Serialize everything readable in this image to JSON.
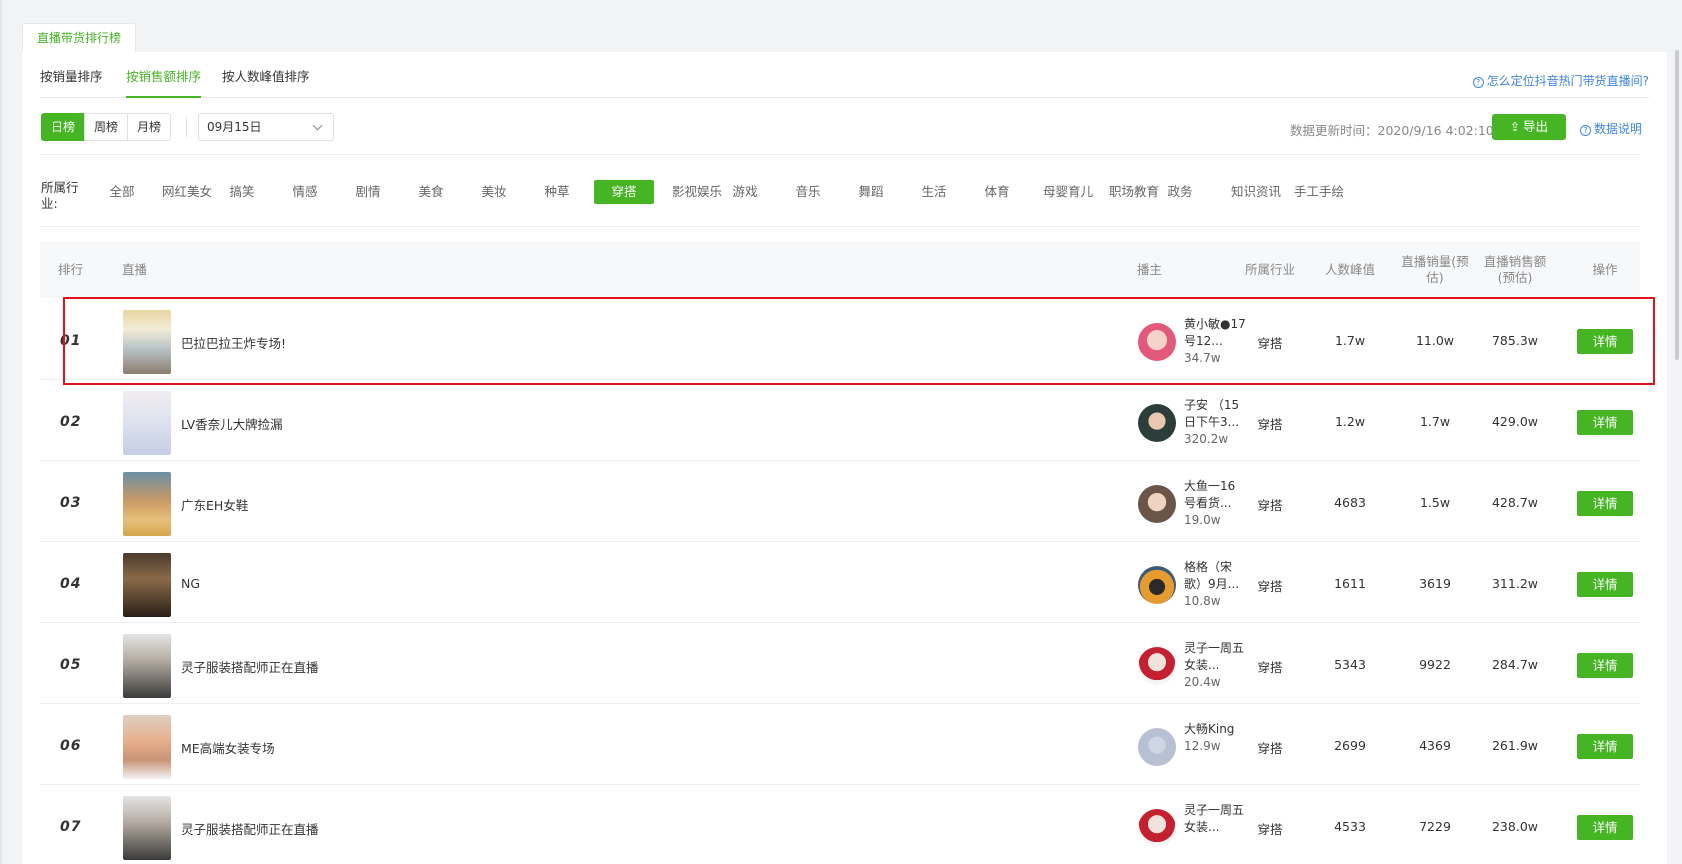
{
  "outer_tab": "直播带货排行榜",
  "sort_tabs": [
    "按销量排序",
    "按销售额排序",
    "按人数峰值排序"
  ],
  "active_sort_tab": 1,
  "help_link": "怎么定位抖音热门带货直播间?",
  "period_buttons": [
    "日榜",
    "周榜",
    "月榜"
  ],
  "active_period": 0,
  "date_value": "09月15日",
  "update_time": "数据更新时间：2020/9/16 4:02:10",
  "export_label": "导出",
  "data_explain": "数据说明",
  "industry_label": "所属行业:",
  "industries": [
    "全部",
    "网红美女",
    "搞笑",
    "情感",
    "剧情",
    "美食",
    "美妆",
    "种草",
    "穿搭",
    "影视娱乐",
    "游戏",
    "音乐",
    "舞蹈",
    "生活",
    "体育",
    "母婴育儿",
    "职场教育",
    "政务",
    "知识资讯",
    "手工手绘"
  ],
  "active_industry": "穿搭",
  "table_headers": {
    "rank": "排行",
    "live": "直播",
    "anchor": "播主",
    "industry": "所属行业",
    "peak": "人数峰值",
    "sales": "直播销量(预估)",
    "revenue": "直播销售额(预估)",
    "action": "操作"
  },
  "rows": [
    {
      "rank": "01",
      "title": "巴拉巴拉王炸专场!",
      "anchor": "黄小敏●17号12...",
      "fans": "34.7w",
      "industry": "穿搭",
      "peak": "1.7w",
      "sales": "11.0w",
      "revenue": "785.3w",
      "action": "详情"
    },
    {
      "rank": "02",
      "title": "LV香奈儿大牌捡漏",
      "anchor": "子安 （15日下午3...",
      "fans": "320.2w",
      "industry": "穿搭",
      "peak": "1.2w",
      "sales": "1.7w",
      "revenue": "429.0w",
      "action": "详情"
    },
    {
      "rank": "03",
      "title": "广东EH女鞋",
      "anchor": "大鱼一16号看货...",
      "fans": "19.0w",
      "industry": "穿搭",
      "peak": "4683",
      "sales": "1.5w",
      "revenue": "428.7w",
      "action": "详情"
    },
    {
      "rank": "04",
      "title": "NG",
      "anchor": "格格（宋歌）9月...",
      "fans": "10.8w",
      "industry": "穿搭",
      "peak": "1611",
      "sales": "3619",
      "revenue": "311.2w",
      "action": "详情"
    },
    {
      "rank": "05",
      "title": "灵子服装搭配师正在直播",
      "anchor": "灵子一周五女装...",
      "fans": "20.4w",
      "industry": "穿搭",
      "peak": "5343",
      "sales": "9922",
      "revenue": "284.7w",
      "action": "详情"
    },
    {
      "rank": "06",
      "title": "ME高端女装专场",
      "anchor": "大畅King",
      "fans": "12.9w",
      "industry": "穿搭",
      "peak": "2699",
      "sales": "4369",
      "revenue": "261.9w",
      "action": "详情"
    },
    {
      "rank": "07",
      "title": "灵子服装搭配师正在直播",
      "anchor": "灵子一周五女装...",
      "fans": "",
      "industry": "穿搭",
      "peak": "4533",
      "sales": "7229",
      "revenue": "238.0w",
      "action": "详情"
    }
  ],
  "colors": {
    "accent": "#45b523",
    "link": "#3f85e6",
    "highlight": "#e0121a"
  }
}
